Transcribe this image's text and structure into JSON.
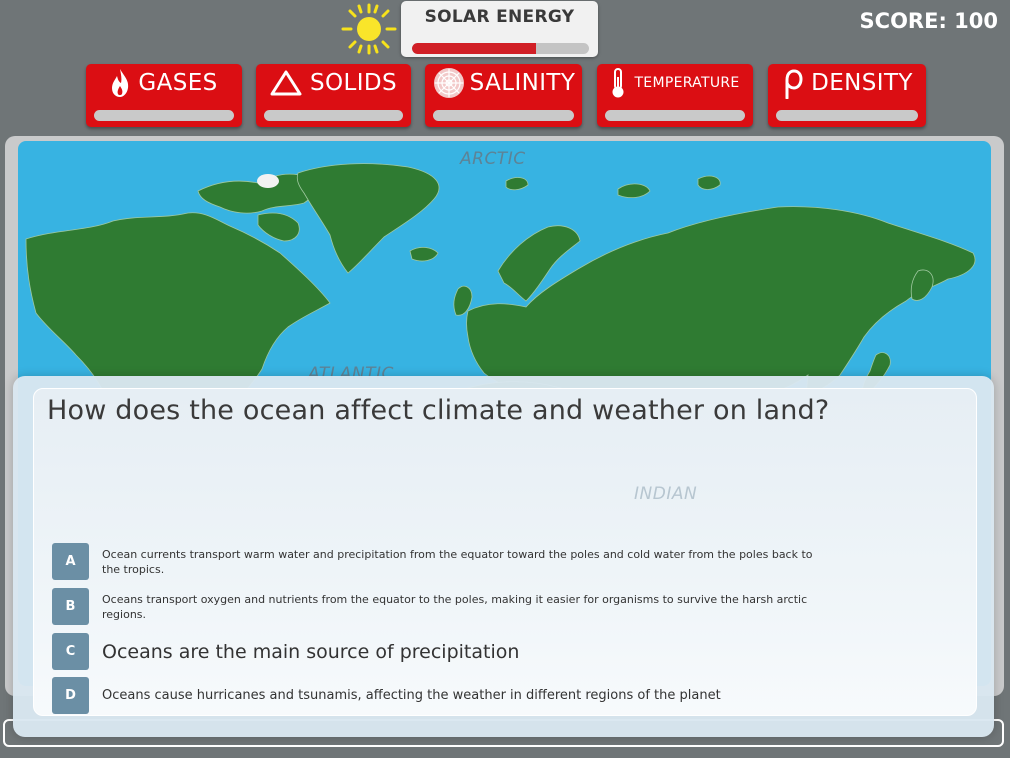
{
  "header": {
    "energy_label": "SOLAR ENERGY",
    "energy_level": 0.7,
    "score_text": "SCORE: 100"
  },
  "categories": [
    {
      "label": "GASES",
      "icon": "flame-icon"
    },
    {
      "label": "SOLIDS",
      "icon": "triangle-icon"
    },
    {
      "label": "SALINITY",
      "icon": "salt-crystal-icon"
    },
    {
      "label": "TEMPERATURE",
      "icon": "thermometer-icon"
    },
    {
      "label": "DENSITY",
      "icon": "rho-icon"
    }
  ],
  "map": {
    "labels": [
      "ARCTIC",
      "ATLANTIC",
      "INDIAN"
    ]
  },
  "question": {
    "text": "How does the ocean affect climate and weather on land?",
    "answers": [
      {
        "letter": "A",
        "text": "Ocean currents transport warm water and precipitation from the equator toward the poles and cold water from the poles back to the tropics."
      },
      {
        "letter": "B",
        "text": "Oceans transport oxygen and nutrients from the equator to the poles, making it easier for organisms to survive the harsh arctic regions."
      },
      {
        "letter": "C",
        "text": "Oceans are the main source of precipitation"
      },
      {
        "letter": "D",
        "text": "Oceans cause hurricanes and tsunamis, affecting the weather in different regions of the planet"
      }
    ]
  },
  "colors": {
    "button_red": "#db0e13",
    "ocean_blue": "#37b3e2",
    "land_green": "#2f7b32",
    "answer_badge": "#6b8fa5",
    "energy_fill": "#d11f26"
  }
}
